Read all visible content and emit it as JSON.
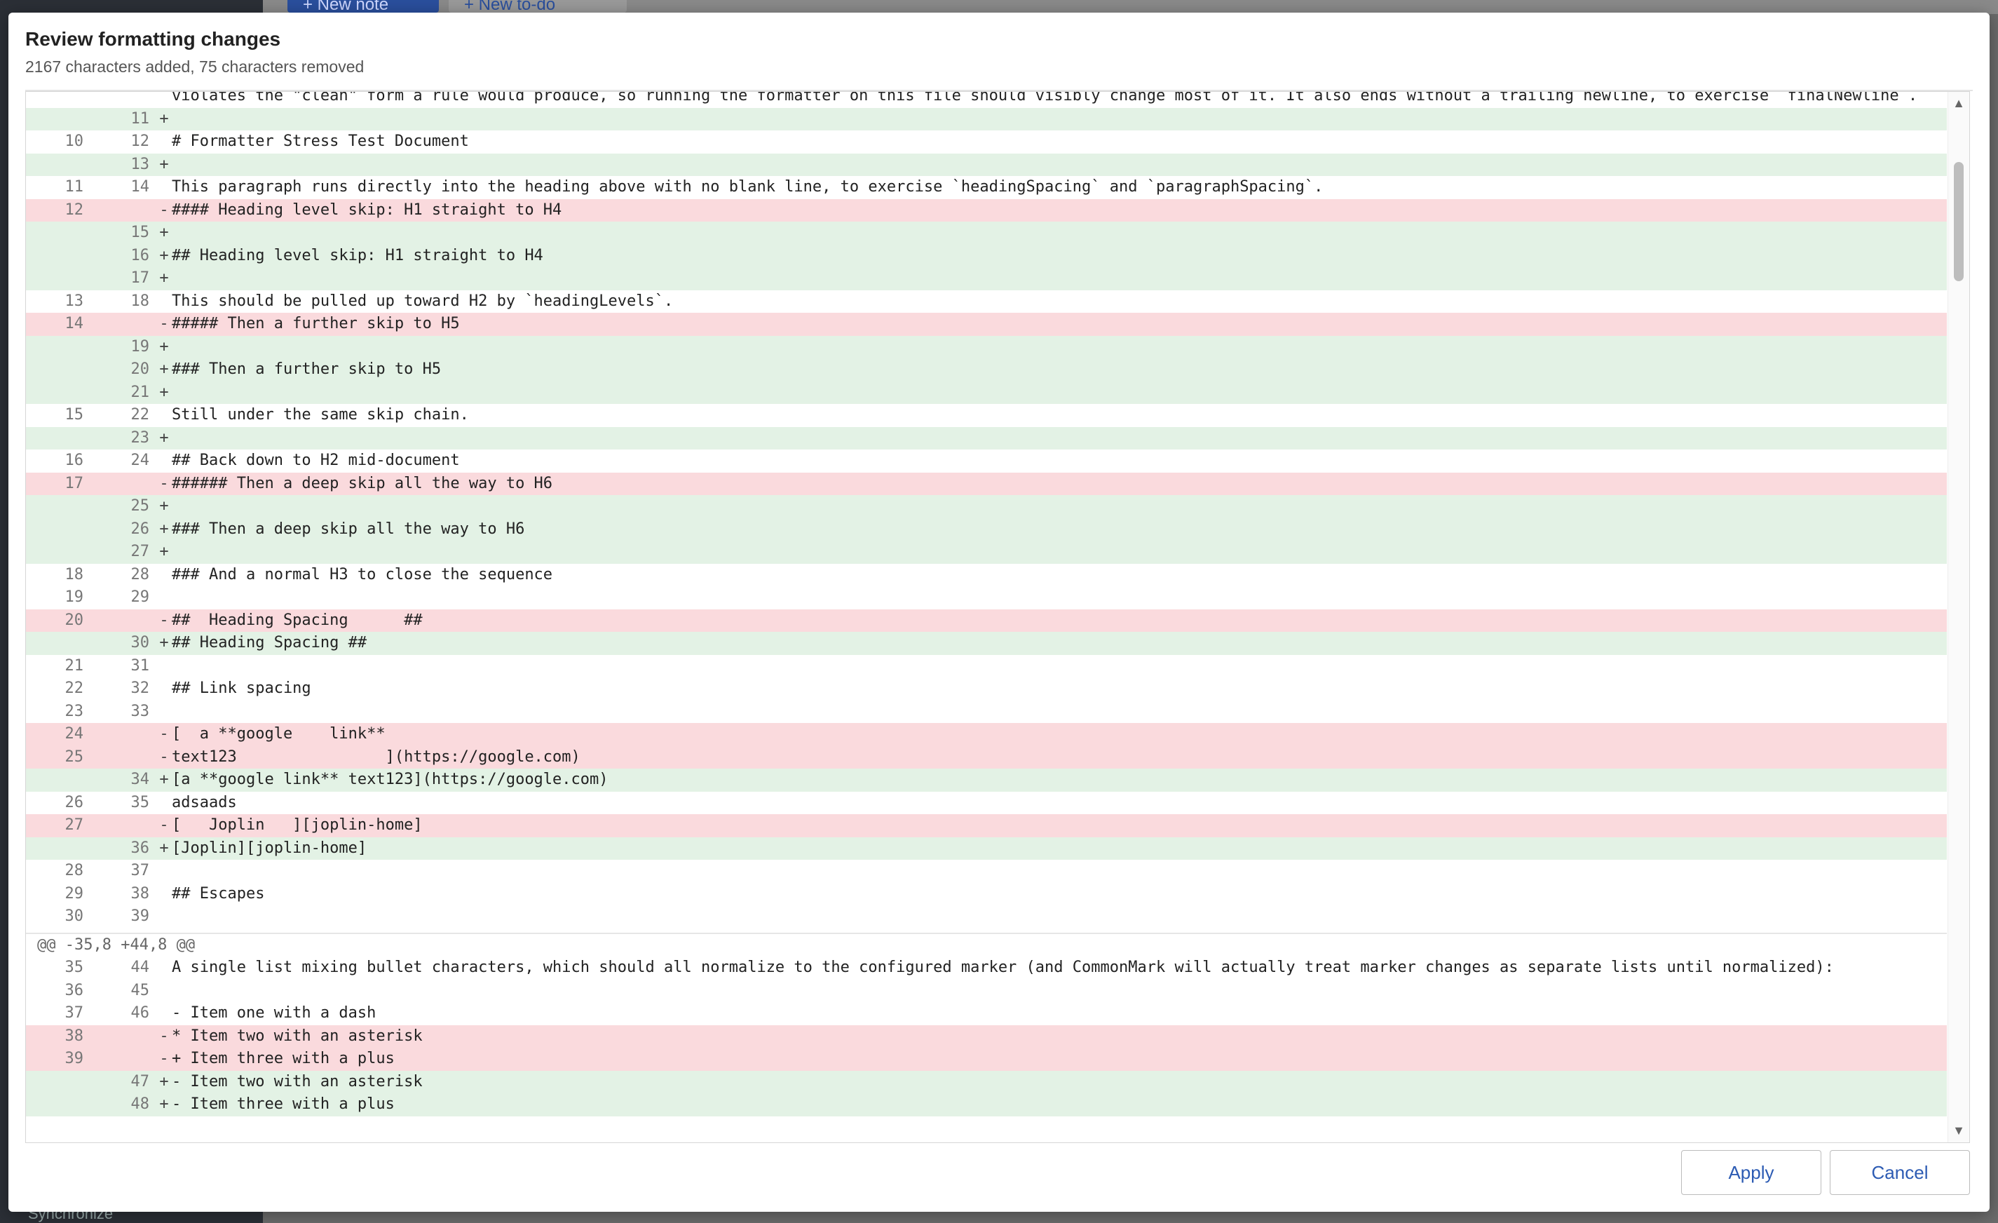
{
  "background": {
    "new_note": "+ New note",
    "new_todo": "+ New to-do",
    "synchronize": "Synchronize"
  },
  "dialog": {
    "title": "Review formatting changes",
    "subtitle": "2167 characters added, 75 characters removed",
    "apply_label": "Apply",
    "cancel_label": "Cancel"
  },
  "diff": {
    "top_cut_line": "violates the \"clean\" form a rule would produce, so running the formatter on this file should visibly change most of it. It also ends without a trailing newline, to exercise `finalNewline`.",
    "hunk2_header": "@@ -35,8 +44,8 @@",
    "rows": [
      {
        "t": "add",
        "o": "",
        "n": "11",
        "c": ""
      },
      {
        "t": "ctx",
        "o": "10",
        "n": "12",
        "c": "# Formatter Stress Test Document"
      },
      {
        "t": "add",
        "o": "",
        "n": "13",
        "c": ""
      },
      {
        "t": "ctx",
        "o": "11",
        "n": "14",
        "c": "This paragraph runs directly into the heading above with no blank line, to exercise `headingSpacing` and `paragraphSpacing`."
      },
      {
        "t": "del",
        "o": "12",
        "n": "",
        "c": "#### Heading level skip: H1 straight to H4"
      },
      {
        "t": "add",
        "o": "",
        "n": "15",
        "c": ""
      },
      {
        "t": "add",
        "o": "",
        "n": "16",
        "c": "## Heading level skip: H1 straight to H4"
      },
      {
        "t": "add",
        "o": "",
        "n": "17",
        "c": ""
      },
      {
        "t": "ctx",
        "o": "13",
        "n": "18",
        "c": "This should be pulled up toward H2 by `headingLevels`."
      },
      {
        "t": "del",
        "o": "14",
        "n": "",
        "c": "##### Then a further skip to H5"
      },
      {
        "t": "add",
        "o": "",
        "n": "19",
        "c": ""
      },
      {
        "t": "add",
        "o": "",
        "n": "20",
        "c": "### Then a further skip to H5"
      },
      {
        "t": "add",
        "o": "",
        "n": "21",
        "c": ""
      },
      {
        "t": "ctx",
        "o": "15",
        "n": "22",
        "c": "Still under the same skip chain."
      },
      {
        "t": "add",
        "o": "",
        "n": "23",
        "c": ""
      },
      {
        "t": "ctx",
        "o": "16",
        "n": "24",
        "c": "## Back down to H2 mid-document"
      },
      {
        "t": "del",
        "o": "17",
        "n": "",
        "c": "###### Then a deep skip all the way to H6"
      },
      {
        "t": "add",
        "o": "",
        "n": "25",
        "c": ""
      },
      {
        "t": "add",
        "o": "",
        "n": "26",
        "c": "### Then a deep skip all the way to H6"
      },
      {
        "t": "add",
        "o": "",
        "n": "27",
        "c": ""
      },
      {
        "t": "ctx",
        "o": "18",
        "n": "28",
        "c": "### And a normal H3 to close the sequence"
      },
      {
        "t": "ctx",
        "o": "19",
        "n": "29",
        "c": ""
      },
      {
        "t": "del",
        "o": "20",
        "n": "",
        "c": "##  Heading Spacing      ##"
      },
      {
        "t": "add",
        "o": "",
        "n": "30",
        "c": "## Heading Spacing ##"
      },
      {
        "t": "ctx",
        "o": "21",
        "n": "31",
        "c": ""
      },
      {
        "t": "ctx",
        "o": "22",
        "n": "32",
        "c": "## Link spacing"
      },
      {
        "t": "ctx",
        "o": "23",
        "n": "33",
        "c": ""
      },
      {
        "t": "del",
        "o": "24",
        "n": "",
        "c": "[  a **google    link**"
      },
      {
        "t": "del",
        "o": "25",
        "n": "",
        "c": "text123                ](https://google.com)"
      },
      {
        "t": "add",
        "o": "",
        "n": "34",
        "c": "[a **google link** text123](https://google.com)"
      },
      {
        "t": "ctx",
        "o": "26",
        "n": "35",
        "c": "adsaads"
      },
      {
        "t": "del",
        "o": "27",
        "n": "",
        "c": "[   Joplin   ][joplin-home]"
      },
      {
        "t": "add",
        "o": "",
        "n": "36",
        "c": "[Joplin][joplin-home]"
      },
      {
        "t": "ctx",
        "o": "28",
        "n": "37",
        "c": ""
      },
      {
        "t": "ctx",
        "o": "29",
        "n": "38",
        "c": "## Escapes"
      },
      {
        "t": "ctx",
        "o": "30",
        "n": "39",
        "c": ""
      }
    ],
    "rows2": [
      {
        "t": "ctx",
        "o": "35",
        "n": "44",
        "c": "A single list mixing bullet characters, which should all normalize to the configured marker (and CommonMark will actually treat marker changes as separate lists until normalized):"
      },
      {
        "t": "ctx",
        "o": "36",
        "n": "45",
        "c": ""
      },
      {
        "t": "ctx",
        "o": "37",
        "n": "46",
        "c": "- Item one with a dash"
      },
      {
        "t": "del",
        "o": "38",
        "n": "",
        "c": "* Item two with an asterisk"
      },
      {
        "t": "del",
        "o": "39",
        "n": "",
        "c": "+ Item three with a plus"
      },
      {
        "t": "add",
        "o": "",
        "n": "47",
        "c": "- Item two with an asterisk"
      },
      {
        "t": "add",
        "o": "",
        "n": "48",
        "c": "- Item three with a plus"
      }
    ]
  }
}
